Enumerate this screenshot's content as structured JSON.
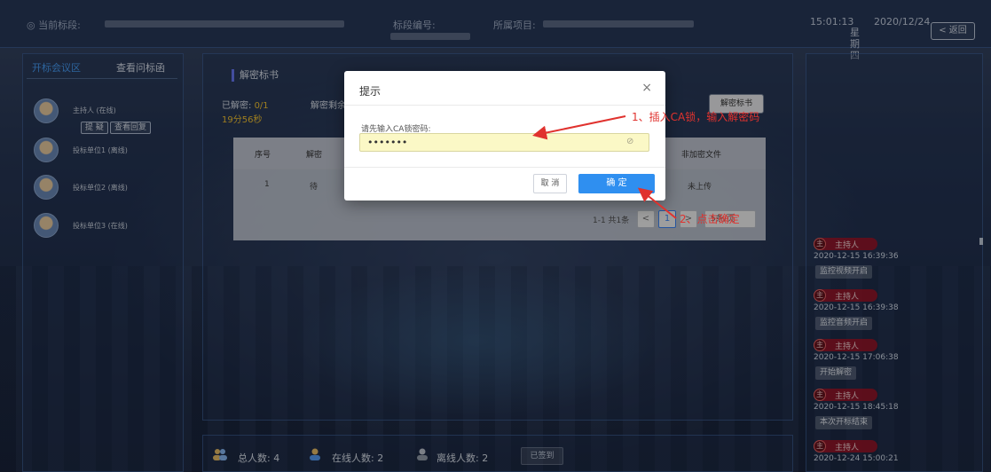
{
  "header": {
    "current_section_label": "◎ 当前标段:",
    "current_section_value": "",
    "section_number_label": "标段编号:",
    "project_label": "所属项目:",
    "time": "15:01:13",
    "weekday": "星期四",
    "date": "2020/12/24",
    "back_label": "< 返回"
  },
  "left_panel": {
    "tab_active": "开标会议区",
    "tab_other": "查看问标函",
    "members": [
      {
        "name": "主持人 (在线)"
      },
      {
        "name": "投标单位1 (离线)"
      },
      {
        "name": "投标单位2 (离线)"
      },
      {
        "name": "投标单位3 (在线)"
      }
    ],
    "question_btn": "提 疑",
    "view_reply_btn": "查看回复"
  },
  "center": {
    "title": "解密标书",
    "decrypted_label": "已解密:",
    "decrypted_value": "0/1",
    "remaining_label": "解密剩余",
    "timer": "19分56秒",
    "decrypt_btn": "解密标书",
    "table": {
      "headers": [
        "序号",
        "解密",
        "非加密文件"
      ],
      "rows": [
        [
          "1",
          "待",
          "未上传"
        ]
      ]
    },
    "pager": {
      "summary": "1-1 共1条",
      "prev": "<",
      "current": "1",
      "next": ">",
      "page_size": "5条/页"
    }
  },
  "modal": {
    "title": "提示",
    "close": "×",
    "field_label": "请先输入CA锁密码:",
    "password_value": "•••••••",
    "cancel": "取 消",
    "confirm": "确 定"
  },
  "annotations": {
    "step1": "1、插入CA锁，输入解密码",
    "step2": "2、点击确定"
  },
  "chat": [
    {
      "role": "主持人",
      "time": "2020-12-15 16:39:36",
      "msg": "监控视频开启"
    },
    {
      "role": "主持人",
      "time": "2020-12-15 16:39:38",
      "msg": "监控音频开启"
    },
    {
      "role": "主持人",
      "time": "2020-12-15 17:06:38",
      "msg": "开始解密"
    },
    {
      "role": "主持人",
      "time": "2020-12-15 18:45:18",
      "msg": "本次开标结束"
    },
    {
      "role": "主持人",
      "time": "2020-12-24 15:00:21",
      "msg": ""
    }
  ],
  "chat_role_icon": "主",
  "stats": {
    "total": "总人数: 4",
    "online": "在线人数: 2",
    "offline": "离线人数: 2",
    "signed_btn": "已签到"
  },
  "colors": {
    "accent": "#2f8ff0",
    "annotation_red": "#e0322e",
    "warning": "#ffcc33"
  }
}
